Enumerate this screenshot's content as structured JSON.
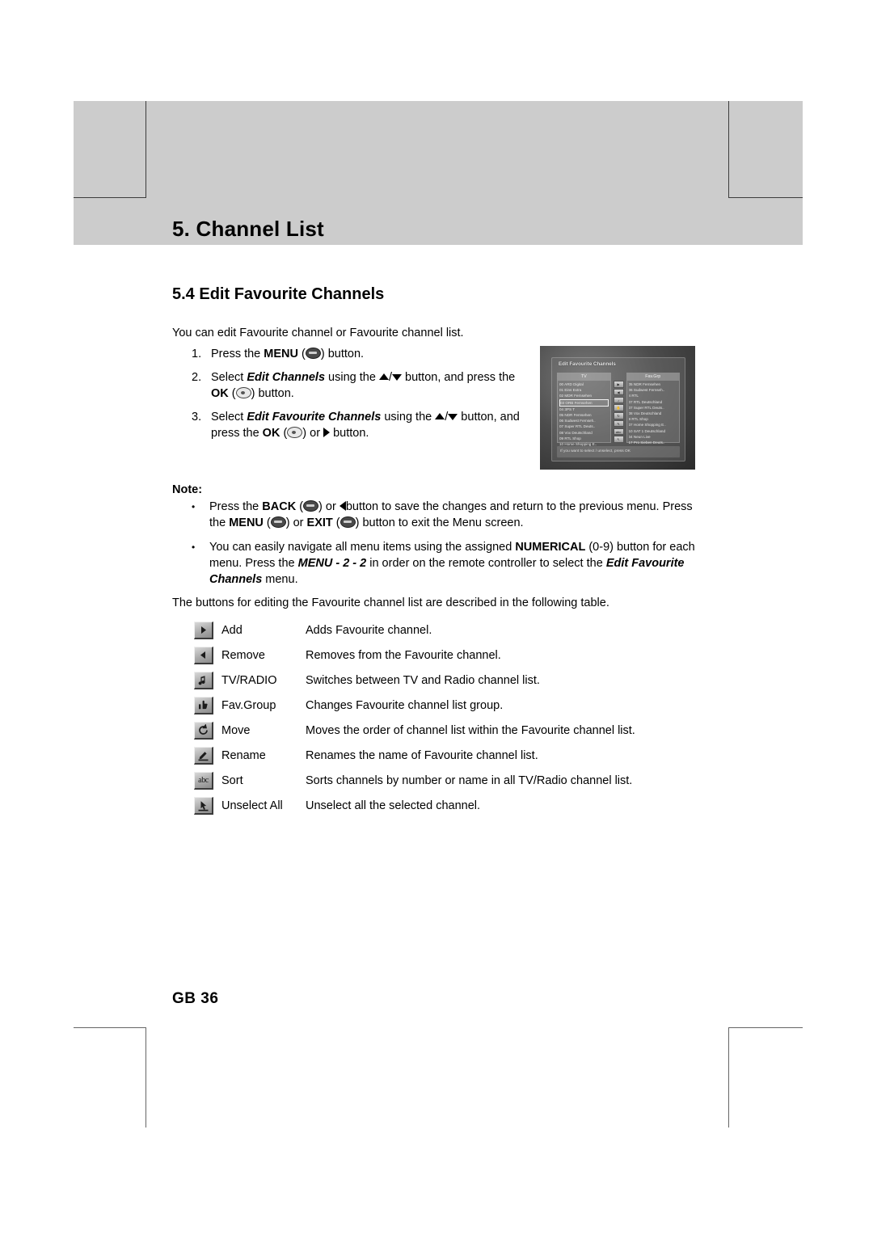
{
  "page": {
    "chapter_title": "5. Channel List",
    "section_title": "5.4 Edit Favourite Channels",
    "intro": "You can edit Favourite channel or Favourite channel list.",
    "folio": "GB 36"
  },
  "steps": [
    {
      "number": "1.",
      "parts": [
        {
          "t": "Press the ",
          "style": "normal"
        },
        {
          "t": "MENU",
          "style": "bold"
        },
        {
          "t": " (",
          "style": "normal"
        },
        {
          "t": "menu-button-icon",
          "style": "icon-dark"
        },
        {
          "t": ") button.",
          "style": "normal"
        }
      ]
    },
    {
      "number": "2.",
      "parts": [
        {
          "t": "Select ",
          "style": "normal"
        },
        {
          "t": "Edit Channels",
          "style": "bold-italic"
        },
        {
          "t": " using the ",
          "style": "normal"
        },
        {
          "t": "up-arrow-icon",
          "style": "icon-tri-up"
        },
        {
          "t": "/",
          "style": "normal"
        },
        {
          "t": "down-arrow-icon",
          "style": "icon-tri-down"
        },
        {
          "t": " button, and press the ",
          "style": "normal"
        },
        {
          "t": "OK",
          "style": "bold"
        },
        {
          "t": " (",
          "style": "normal"
        },
        {
          "t": "ok-button-icon",
          "style": "icon-light"
        },
        {
          "t": ") button.",
          "style": "normal"
        }
      ]
    },
    {
      "number": "3.",
      "parts": [
        {
          "t": "Select ",
          "style": "normal"
        },
        {
          "t": "Edit Favourite Channels",
          "style": "bold-italic"
        },
        {
          "t": " using the ",
          "style": "normal"
        },
        {
          "t": "up-arrow-icon",
          "style": "icon-tri-up"
        },
        {
          "t": "/",
          "style": "normal"
        },
        {
          "t": "down-arrow-icon",
          "style": "icon-tri-down"
        },
        {
          "t": " button, and press the ",
          "style": "normal"
        },
        {
          "t": "OK",
          "style": "bold"
        },
        {
          "t": " (",
          "style": "normal"
        },
        {
          "t": "ok-button-icon",
          "style": "icon-light"
        },
        {
          "t": ") or ",
          "style": "normal"
        },
        {
          "t": "right-arrow-icon",
          "style": "icon-tri-right"
        },
        {
          "t": " button.",
          "style": "normal"
        }
      ]
    }
  ],
  "note": {
    "label": "Note:",
    "items": [
      {
        "bullet": "•",
        "parts": [
          {
            "t": "Press the ",
            "style": "normal"
          },
          {
            "t": "BACK",
            "style": "bold"
          },
          {
            "t": " (",
            "style": "normal"
          },
          {
            "t": "back-button-icon",
            "style": "icon-dark"
          },
          {
            "t": ") or ",
            "style": "normal"
          },
          {
            "t": "left-arrow-icon",
            "style": "icon-tri-left"
          },
          {
            "t": "button to save the changes and return to the previous menu. Press the ",
            "style": "normal"
          },
          {
            "t": "MENU",
            "style": "bold"
          },
          {
            "t": " (",
            "style": "normal"
          },
          {
            "t": "menu-button-icon",
            "style": "icon-dark"
          },
          {
            "t": ") or ",
            "style": "normal"
          },
          {
            "t": "EXIT",
            "style": "bold"
          },
          {
            "t": " (",
            "style": "normal"
          },
          {
            "t": "exit-button-icon",
            "style": "icon-dark"
          },
          {
            "t": ") button to exit the Menu screen.",
            "style": "normal"
          }
        ]
      },
      {
        "bullet": "•",
        "parts": [
          {
            "t": "You can easily navigate all menu items using the assigned ",
            "style": "normal"
          },
          {
            "t": "NUMERICAL",
            "style": "bold"
          },
          {
            "t": " (0-9) button for each menu. Press the ",
            "style": "normal"
          },
          {
            "t": "MENU - 2 - 2",
            "style": "bold-italic"
          },
          {
            "t": " in order on the remote controller to select the ",
            "style": "normal"
          },
          {
            "t": "Edit Favourite Channels",
            "style": "bold-italic"
          },
          {
            "t": " menu.",
            "style": "normal"
          }
        ]
      }
    ]
  },
  "table": {
    "intro": "The buttons for editing the Favourite channel list are described in the following table.",
    "rows": [
      {
        "icon": "right-arrow-key-icon",
        "label": "Add",
        "description": "Adds Favourite channel."
      },
      {
        "icon": "left-arrow-key-icon",
        "label": "Remove",
        "description": "Removes from the Favourite channel."
      },
      {
        "icon": "music-note-key-icon",
        "label": "TV/RADIO",
        "description": "Switches between TV and Radio channel list."
      },
      {
        "icon": "thumbs-up-key-icon",
        "label": "Fav.Group",
        "description": "Changes Favourite channel list group."
      },
      {
        "icon": "refresh-cycle-key-icon",
        "label": "Move",
        "description": "Moves the order of channel list within the Favourite channel list."
      },
      {
        "icon": "pencil-key-icon",
        "label": "Rename",
        "description": "Renames the name of Favourite channel list."
      },
      {
        "icon": "abc-key-icon",
        "label": "Sort",
        "description": "Sorts channels by number or name in all TV/Radio channel list."
      },
      {
        "icon": "cursor-key-icon",
        "label": "Unselect All",
        "description": "Unselect all the selected channel."
      }
    ]
  },
  "tv_screenshot": {
    "title": "Edit Favourite Channels",
    "left_column_header": "TV",
    "right_column_header": "Fav.Grp",
    "left_channels": [
      "00  ARD Digital",
      "01  Eins Extra",
      "02  MDR Fernsehen",
      "03  ORB Fernsehen",
      "04  3PS T",
      "05  NDR Fernsehen",
      "06  Sudwest Fernseh..",
      "07  Super RTL Deuts..",
      "08  Vox Deutschland",
      "09  RTL Shop",
      "10  Home Shopping E.."
    ],
    "right_channels": [
      "05  NDR Fernsehen",
      "06  Sudwest Fernseh..",
      "4  RTL",
      "07  RTL Deutschland",
      "07  Super RTL Deuts..",
      "08  Vox Deutschland",
      "9  RTL Shop",
      "07  Home Shopping E..",
      "10  SAT 1 Deutschland",
      "04  Neun Live",
      "17  Pro Sieben Deuts.."
    ],
    "middle_buttons": [
      "▶",
      "◀",
      "♪",
      "✋",
      "↻",
      "✎",
      "abc",
      "↖"
    ],
    "status_text": "If you want to select / unselect, press OK"
  },
  "colors": {
    "header_band": "#cccccc",
    "crop_mark": "#3d3d3d",
    "text": "#000000",
    "page_background": "#ffffff"
  }
}
